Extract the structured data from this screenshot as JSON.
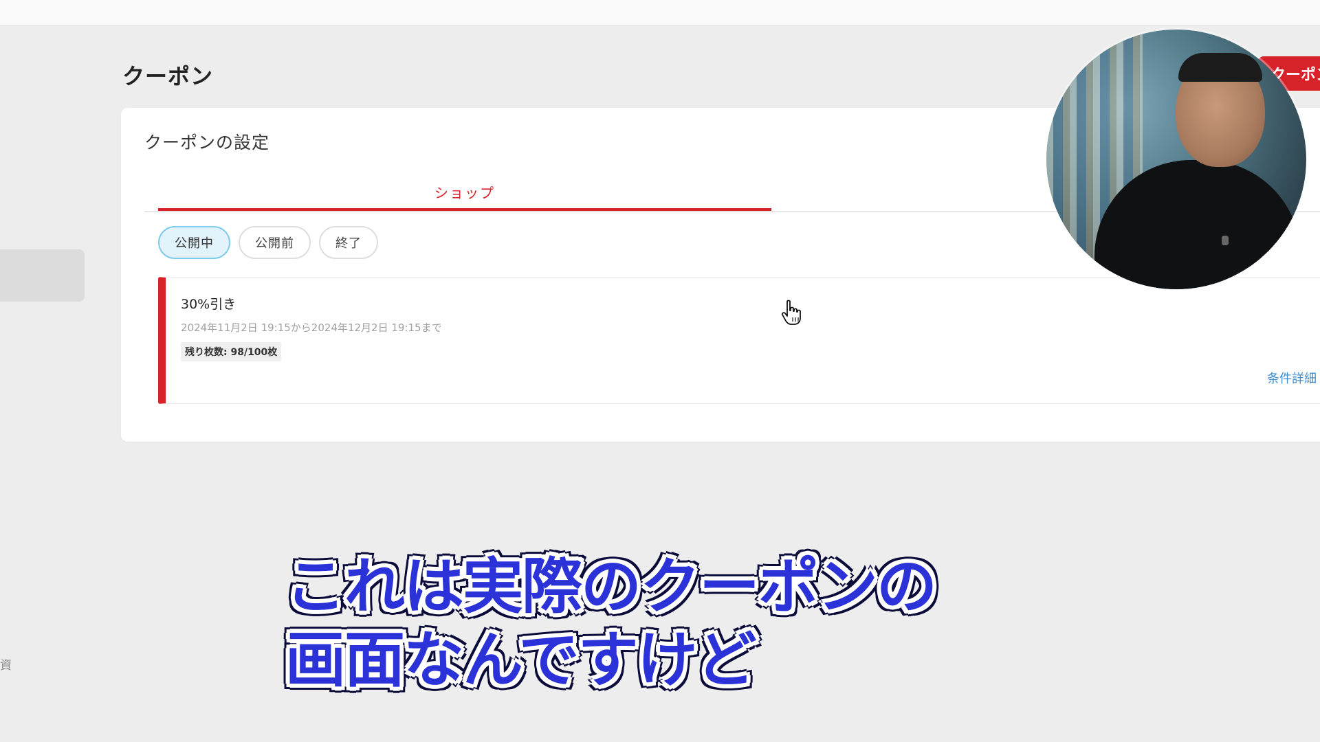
{
  "page": {
    "title": "クーポン",
    "top_button_label": "クーポン作成"
  },
  "sidebar": {
    "partial_label": "資"
  },
  "card": {
    "title": "クーポンの設定",
    "tabs": [
      {
        "label": "ショップ",
        "active": true
      }
    ],
    "status_filters": [
      {
        "label": "公開中",
        "active": true
      },
      {
        "label": "公開前",
        "active": false
      },
      {
        "label": "終了",
        "active": false
      }
    ],
    "coupons": [
      {
        "name": "30%引き",
        "period": "2024年11月2日 19:15から2024年12月2日 19:15まで",
        "remaining": "残り枚数: 98/100枚",
        "detail_link": "条件詳細"
      }
    ]
  },
  "subtitle": {
    "line1": "これは実際のクーポンの",
    "line2": "画面なんですけど"
  },
  "colors": {
    "accent_red": "#d7222a",
    "active_pill_bg": "#e3f3fb",
    "link_blue": "#3d8fd4",
    "subtitle_blue": "#2a32d8"
  },
  "icons": {
    "cursor": "hand-pointer-icon"
  }
}
